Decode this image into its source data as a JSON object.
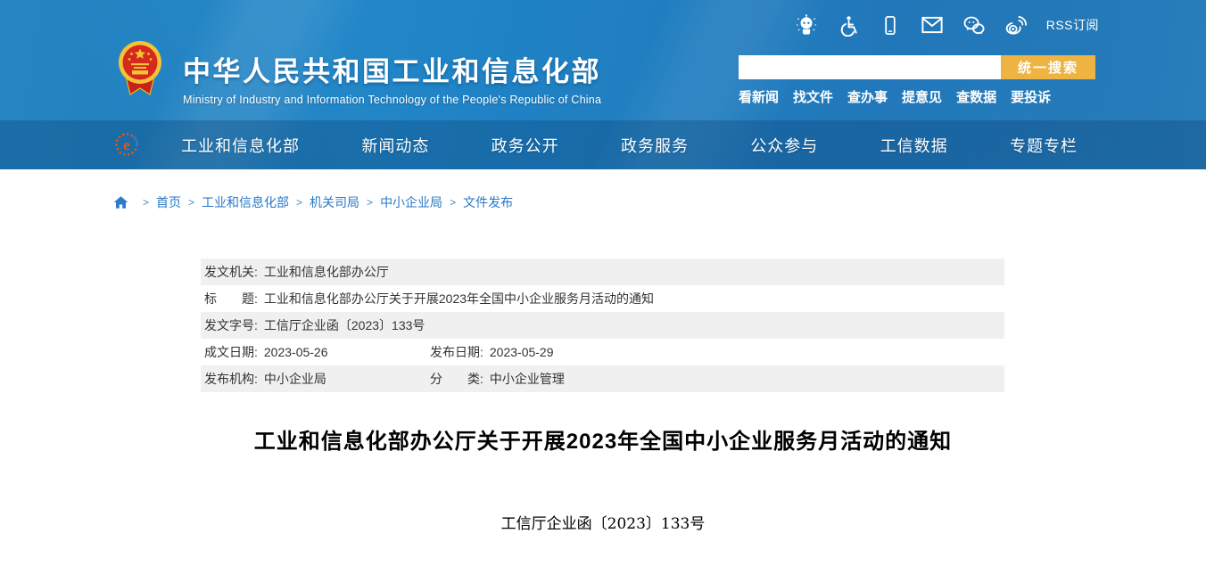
{
  "colors": {
    "header_blue": "#1f83c5",
    "nav_band": "#1e6fae",
    "search_button_orange": "#efb342",
    "link_blue": "#2778c7",
    "row_gray": "#f0f0f0"
  },
  "header": {
    "utility": {
      "icons": [
        "robot-icon",
        "accessibility-icon",
        "mobile-icon",
        "mail-icon",
        "wechat-icon",
        "weibo-icon"
      ],
      "rss_label": "RSS订阅"
    },
    "brand": {
      "title": "中华人民共和国工业和信息化部",
      "subtitle": "Ministry of Industry and Information Technology of the People's Republic of China"
    },
    "search": {
      "input_value": "",
      "input_placeholder": "",
      "button_label": "统一搜索"
    },
    "quick_links": [
      "看新闻",
      "找文件",
      "查办事",
      "提意见",
      "查数据",
      "要投诉"
    ],
    "nav_items": [
      "工业和信息化部",
      "新闻动态",
      "政务公开",
      "政务服务",
      "公众参与",
      "工信数据",
      "专题专栏"
    ]
  },
  "breadcrumb": {
    "separator": ">",
    "items": [
      "首页",
      "工业和信息化部",
      "机关司局",
      "中小企业局",
      "文件发布"
    ]
  },
  "meta_table": {
    "rows": [
      {
        "cells": [
          {
            "label": "发文机关:",
            "value": "工业和信息化部办公厅"
          }
        ]
      },
      {
        "cells": [
          {
            "label": "标　　题:",
            "value": "工业和信息化部办公厅关于开展2023年全国中小企业服务月活动的通知"
          }
        ]
      },
      {
        "cells": [
          {
            "label": "发文字号:",
            "value": "工信厅企业函〔2023〕133号"
          }
        ]
      },
      {
        "cells": [
          {
            "label": "成文日期:",
            "value": "2023-05-26"
          },
          {
            "label": "发布日期:",
            "value": "2023-05-29"
          }
        ]
      },
      {
        "cells": [
          {
            "label": "发布机构:",
            "value": "中小企业局"
          },
          {
            "label": "分　　类:",
            "value": "中小企业管理"
          }
        ]
      }
    ]
  },
  "article": {
    "title": "工业和信息化部办公厅关于开展2023年全国中小企业服务月活动的通知",
    "doc_number": "工信厅企业函〔2023〕133号"
  }
}
